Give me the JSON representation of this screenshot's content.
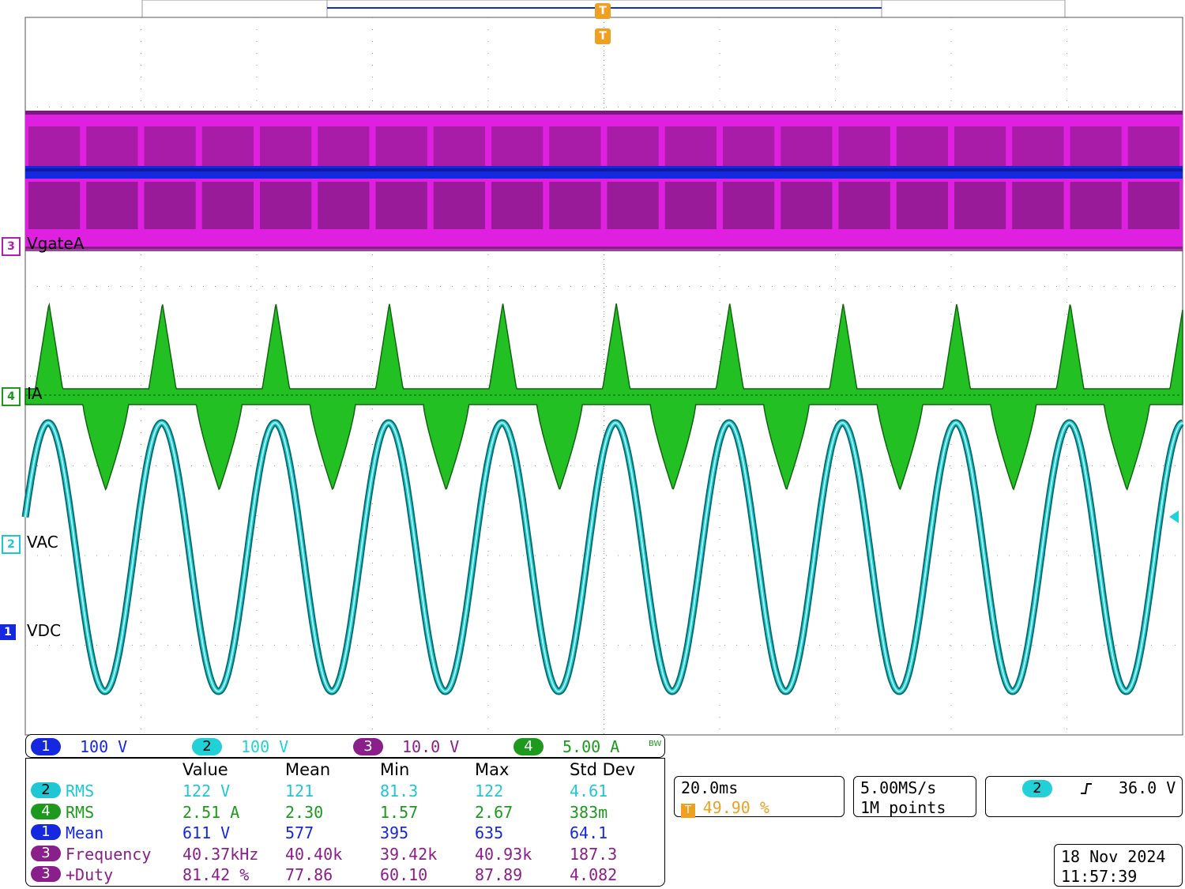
{
  "channels": {
    "ch3": {
      "num": "3",
      "label": "VgateA",
      "color": "#e020e0",
      "dark": "#7a1a7a"
    },
    "ch4": {
      "num": "4",
      "label": "IA",
      "color": "#22c022",
      "dark": "#116611"
    },
    "ch2": {
      "num": "2",
      "label": "VAC",
      "color": "#22d0d8",
      "dark": "#0e6c70"
    },
    "ch1": {
      "num": "1",
      "label": "VDC",
      "color": "#1428e0"
    }
  },
  "trigger_marker": "T",
  "scale_bar": [
    {
      "num": "1",
      "value": "100 V",
      "color": "#1428e0"
    },
    {
      "num": "2",
      "value": "100 V",
      "color": "#22d0d8"
    },
    {
      "num": "3",
      "value": "10.0 V",
      "color": "#8a1e8a"
    },
    {
      "num": "4",
      "value": "5.00 A",
      "color": "#1d9a1d"
    }
  ],
  "bandwidth_icon": "BW",
  "measurements": {
    "headers": [
      "Value",
      "Mean",
      "Min",
      "Max",
      "Std Dev"
    ],
    "rows": [
      {
        "ch": "2",
        "name": "RMS",
        "color": "#1fc7d4",
        "values": [
          "122 V",
          "121",
          "81.3",
          "122",
          "4.61"
        ]
      },
      {
        "ch": "4",
        "name": "RMS",
        "color": "#1d9a1d",
        "values": [
          "2.51 A",
          "2.30",
          "1.57",
          "2.67",
          "383m"
        ]
      },
      {
        "ch": "1",
        "name": "Mean",
        "color": "#1428e0",
        "values": [
          "611 V",
          "577",
          "395",
          "635",
          "64.1"
        ]
      },
      {
        "ch": "3",
        "name": "Frequency",
        "color": "#8a1e8a",
        "values": [
          "40.37kHz",
          "40.40k",
          "39.42k",
          "40.93k",
          "187.3"
        ]
      },
      {
        "ch": "3",
        "name": "+Duty",
        "color": "#8a1e8a",
        "values": [
          "81.42 %",
          "77.86",
          "60.10",
          "87.89",
          "4.082"
        ]
      }
    ]
  },
  "timebase": {
    "scale": "20.0ms",
    "trigger_pos": "49.90 %",
    "trig_icon": "T"
  },
  "acquisition": {
    "rate": "5.00MS/s",
    "points": "1M points"
  },
  "trigger": {
    "source": "2",
    "slope_icon": "rising-edge-icon",
    "level": "36.0 V"
  },
  "datetime": {
    "date": "18 Nov 2024",
    "time": "11:57:39"
  },
  "waveforms": {
    "ch2_sine_cycles": 10.2,
    "ch4_cycles": 10.2,
    "ch3_bursts": 20
  }
}
